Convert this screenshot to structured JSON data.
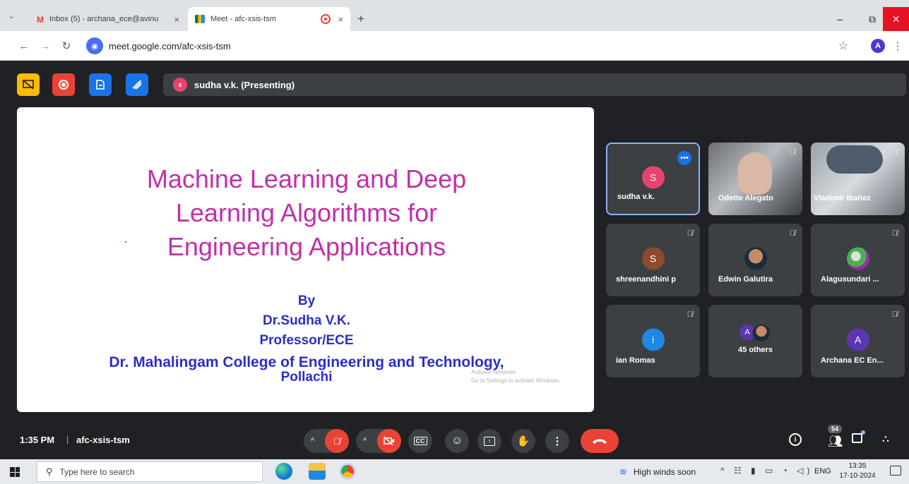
{
  "browser": {
    "tabs": [
      {
        "label": "Inbox (5) - archana_ece@avinu",
        "close": "×"
      },
      {
        "label": "Meet - afc-xsis-tsm",
        "close": "×"
      }
    ],
    "new_tab": "+",
    "url": "meet.google.com/afc-xsis-tsm",
    "profile_initial": "A",
    "window_controls": {
      "minimize": "–",
      "restore": "⧉",
      "close": "×"
    }
  },
  "meet": {
    "presenter": {
      "initial": "s",
      "label": "sudha v.k. (Presenting)"
    },
    "slide": {
      "title": "Machine Learning and  Deep\nLearning Algorithms for\nEngineering Applications",
      "by": "By",
      "author": "Dr.Sudha V.K.",
      "role": "Professor/ECE",
      "institution": "Dr. Mahalingam College of Engineering and Technology,",
      "place": "Pollachi",
      "watermark_line1": "Activate Windows",
      "watermark_line2": "Go to Settings to activate Windows."
    },
    "participants": [
      {
        "name": "sudha v.k.",
        "initial": "S",
        "color": "#e8436e"
      },
      {
        "name": "Odette Alegato"
      },
      {
        "name": "Vladimir Ibañez"
      },
      {
        "name": "shreenandhini p",
        "initial": "S",
        "color": "#8d4a2f"
      },
      {
        "name": "Edwin Galutira"
      },
      {
        "name": "Alagusundari ..."
      },
      {
        "name": "ian Romas",
        "initial": "i",
        "color": "#1e88e5"
      },
      {
        "name": "45 others",
        "initial": "A",
        "color": "#5e35b1"
      },
      {
        "name": "Archana EC En...",
        "initial": "A",
        "color": "#5e35b1"
      }
    ],
    "bottom": {
      "time": "1:35 PM",
      "separator": "|",
      "meeting_code": "afc-xsis-tsm",
      "people_count": "54"
    }
  },
  "taskbar": {
    "search_placeholder": "Type here to search",
    "weather": "High winds soon",
    "language": "ENG",
    "clock_time": "13:35",
    "clock_date": "17-10-2024"
  },
  "colors": {
    "end_call": "#ea4335",
    "accent_blue": "#8ab4f8",
    "slide_title": "#c12fa9",
    "slide_body": "#2b2fc4"
  }
}
